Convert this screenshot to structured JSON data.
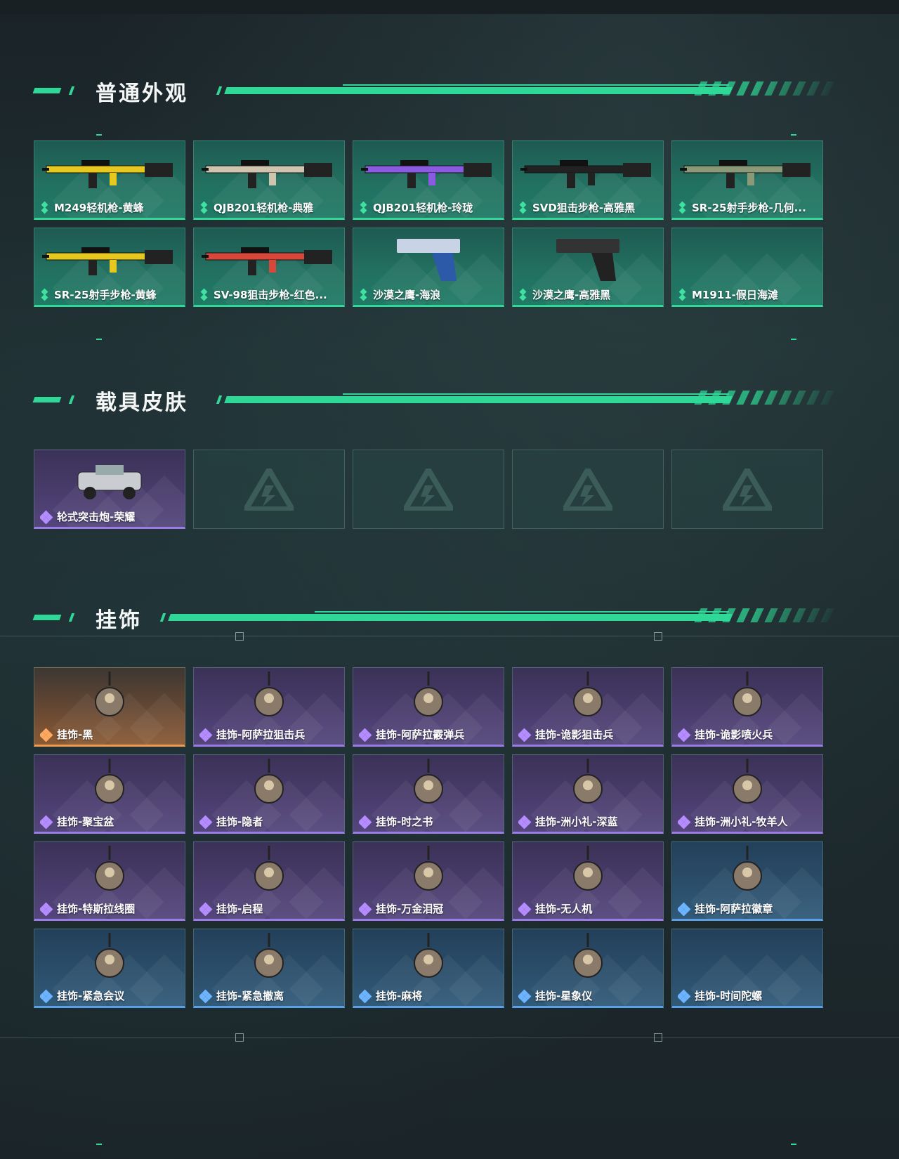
{
  "sections": [
    {
      "title": "普通外观",
      "items": [
        {
          "label": "M249轻机枪-黄蜂",
          "rarity": "green",
          "icon": "rifle-yellow-icon"
        },
        {
          "label": "QJB201轻机枪-典雅",
          "rarity": "green",
          "icon": "rifle-tan-icon"
        },
        {
          "label": "QJB201轻机枪-玲珑",
          "rarity": "green",
          "icon": "rifle-purple-icon"
        },
        {
          "label": "SVD狙击步枪-高雅黑",
          "rarity": "green",
          "icon": "sniper-black-icon"
        },
        {
          "label": "SR-25射手步枪-几何...",
          "rarity": "green",
          "icon": "rifle-camo-icon"
        },
        {
          "label": "SR-25射手步枪-黄蜂",
          "rarity": "green",
          "icon": "rifle-yellow-icon"
        },
        {
          "label": "SV-98狙击步枪-红色...",
          "rarity": "green",
          "icon": "sniper-red-icon"
        },
        {
          "label": "沙漠之鹰-海浪",
          "rarity": "green",
          "icon": "pistol-blue-icon"
        },
        {
          "label": "沙漠之鹰-高雅黑",
          "rarity": "green",
          "icon": "pistol-black-icon"
        },
        {
          "label": "M1911-假日海滩",
          "rarity": "green",
          "icon": ""
        }
      ]
    },
    {
      "title": "载具皮肤",
      "items": [
        {
          "label": "轮式突击炮-荣耀",
          "rarity": "purple",
          "icon": "vehicle-icon"
        }
      ],
      "empty_slots": 4
    },
    {
      "title": "挂饰",
      "items": [
        {
          "label": "挂饰-黑",
          "rarity": "orange",
          "icon": "charm-icon"
        },
        {
          "label": "挂饰-阿萨拉狙击兵",
          "rarity": "purple",
          "icon": "charm-icon"
        },
        {
          "label": "挂饰-阿萨拉霰弹兵",
          "rarity": "purple",
          "icon": "charm-icon"
        },
        {
          "label": "挂饰-诡影狙击兵",
          "rarity": "purple",
          "icon": "charm-icon"
        },
        {
          "label": "挂饰-诡影喷火兵",
          "rarity": "purple",
          "icon": "charm-icon"
        },
        {
          "label": "挂饰-聚宝盆",
          "rarity": "purple",
          "icon": "charm-icon"
        },
        {
          "label": "挂饰-隐者",
          "rarity": "purple",
          "icon": "charm-icon"
        },
        {
          "label": "挂饰-时之书",
          "rarity": "purple",
          "icon": "charm-icon"
        },
        {
          "label": "挂饰-洲小礼-深蓝",
          "rarity": "purple",
          "icon": "charm-icon"
        },
        {
          "label": "挂饰-洲小礼-牧羊人",
          "rarity": "purple",
          "icon": "charm-icon"
        },
        {
          "label": "挂饰-特斯拉线圈",
          "rarity": "purple",
          "icon": "charm-icon"
        },
        {
          "label": "挂饰-启程",
          "rarity": "purple",
          "icon": "charm-icon"
        },
        {
          "label": "挂饰-万金泪冠",
          "rarity": "purple",
          "icon": "charm-icon"
        },
        {
          "label": "挂饰-无人机",
          "rarity": "purple",
          "icon": "charm-icon"
        },
        {
          "label": "挂饰-阿萨拉徽章",
          "rarity": "blue",
          "icon": "charm-icon"
        },
        {
          "label": "挂饰-紧急会议",
          "rarity": "blue",
          "icon": "charm-icon"
        },
        {
          "label": "挂饰-紧急撤离",
          "rarity": "blue",
          "icon": "charm-icon"
        },
        {
          "label": "挂饰-麻将",
          "rarity": "blue",
          "icon": "charm-icon"
        },
        {
          "label": "挂饰-星象仪",
          "rarity": "blue",
          "icon": "charm-icon"
        },
        {
          "label": "挂饰-时间陀螺",
          "rarity": "blue",
          "icon": ""
        }
      ]
    }
  ],
  "colors": {
    "accent": "#2fd896",
    "green": "#2fd896",
    "purple": "#9b7bea",
    "orange": "#f09a50",
    "blue": "#5aa0e8"
  }
}
